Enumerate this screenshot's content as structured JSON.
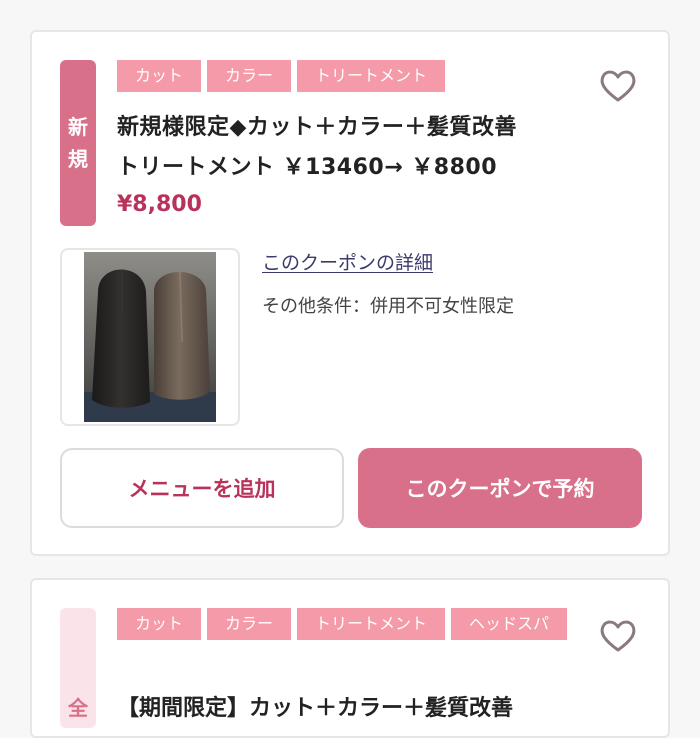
{
  "coupons": [
    {
      "badge": [
        "新",
        "規"
      ],
      "tags": [
        "カット",
        "カラー",
        "トリートメント"
      ],
      "title_line1": "新規様限定◆カット＋カラー＋髪質改善",
      "title_line2": "トリートメント ￥13460→ ￥8800",
      "price": "¥8,800",
      "detail_link": "このクーポンの詳細",
      "conditions": "その他条件：併用不可女性限定",
      "add_menu_label": "メニューを追加",
      "reserve_label": "このクーポンで予約"
    },
    {
      "badge": [
        "全"
      ],
      "tags": [
        "カット",
        "カラー",
        "トリートメント",
        "ヘッドスパ"
      ],
      "title_partial": "【期間限定】カット＋カラー＋髪質改善"
    }
  ],
  "colors": {
    "accent": "#d9708a",
    "tag": "#f59aa8",
    "price": "#b8325a"
  },
  "icons": {
    "favorite": "heart-outline-icon"
  }
}
